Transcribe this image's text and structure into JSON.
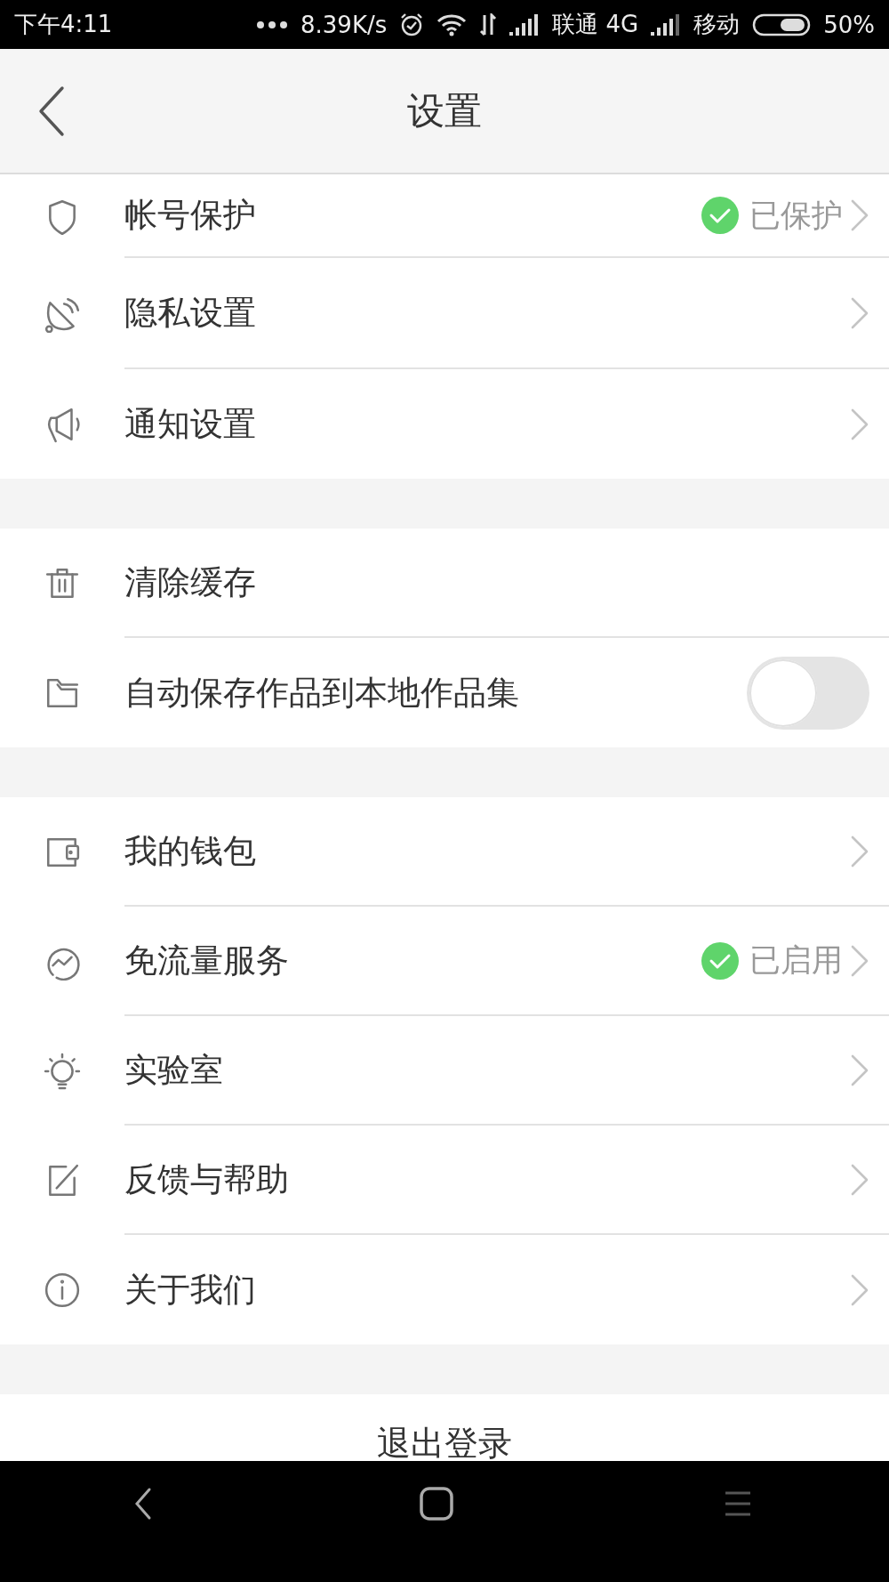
{
  "status_bar": {
    "time": "下午4:11",
    "speed": "8.39K/s",
    "carrier_1": "联通 4G",
    "carrier_2": "移动",
    "battery": "50%"
  },
  "header": {
    "title": "设置"
  },
  "groups": [
    {
      "items": [
        {
          "kind": "link",
          "label": "帐号保护",
          "status": "已保护"
        },
        {
          "kind": "link",
          "label": "隐私设置"
        },
        {
          "kind": "link",
          "label": "通知设置"
        }
      ]
    },
    {
      "items": [
        {
          "kind": "plain",
          "label": "清除缓存"
        },
        {
          "kind": "toggle",
          "label": "自动保存作品到本地作品集",
          "on": false
        }
      ]
    },
    {
      "items": [
        {
          "kind": "link",
          "label": "我的钱包"
        },
        {
          "kind": "link",
          "label": "免流量服务",
          "status": "已启用"
        },
        {
          "kind": "link",
          "label": "实验室"
        },
        {
          "kind": "link",
          "label": "反馈与帮助"
        },
        {
          "kind": "link",
          "label": "关于我们"
        }
      ]
    }
  ],
  "logout": {
    "label": "退出登录"
  }
}
